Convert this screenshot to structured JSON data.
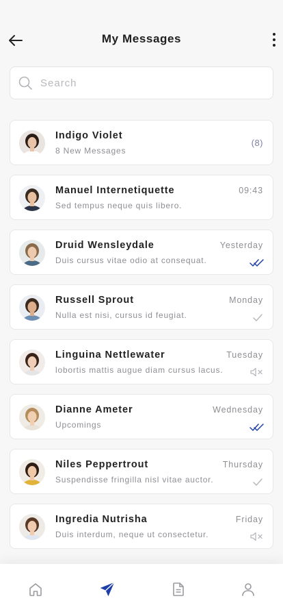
{
  "header": {
    "title": "My Messages"
  },
  "search": {
    "placeholder": "Search"
  },
  "colors": {
    "accent": "#1e3fa8",
    "muted": "#8e8e93",
    "count": "#7c80a6"
  },
  "conversations": [
    {
      "name": "Indigo Violet",
      "preview": "8 New Messages",
      "time": "",
      "count": "(8)",
      "status": "none",
      "avatar": "woman-dark-hair"
    },
    {
      "name": "Manuel Internetiquette",
      "preview": "Sed tempus neque quis libero.",
      "time": "09:43",
      "count": "",
      "status": "none",
      "avatar": "man-suit"
    },
    {
      "name": "Druid Wensleydale",
      "preview": "Duis cursus vitae odio at consequat.",
      "time": "Yesterday",
      "count": "",
      "status": "double-check-read",
      "avatar": "man-light-hair"
    },
    {
      "name": "Russell Sprout",
      "preview": "Nulla est nisi, cursus id feugiat.",
      "time": "Monday",
      "count": "",
      "status": "single-check",
      "avatar": "man-beard"
    },
    {
      "name": "Linguina Nettlewater",
      "preview": "lobortis mattis augue diam cursus lacus.",
      "time": "Tuesday",
      "count": "",
      "status": "muted",
      "avatar": "woman-dark-hair-2"
    },
    {
      "name": "Dianne Ameter",
      "preview": "Upcomings",
      "time": "Wednesday",
      "count": "",
      "status": "double-check-read",
      "avatar": "woman-blonde"
    },
    {
      "name": "Niles Peppertrout",
      "preview": "Suspendisse fringilla nisl vitae auctor.",
      "time": "Thursday",
      "count": "",
      "status": "single-check",
      "avatar": "woman-smiling"
    },
    {
      "name": "Ingredia Nutrisha",
      "preview": "Duis interdum, neque ut consectetur.",
      "time": "Friday",
      "count": "",
      "status": "muted",
      "avatar": "woman-brown-hair"
    }
  ],
  "tabs": [
    {
      "name": "home",
      "icon": "home-icon",
      "active": false
    },
    {
      "name": "messages",
      "icon": "send-icon",
      "active": true
    },
    {
      "name": "documents",
      "icon": "document-icon",
      "active": false
    },
    {
      "name": "profile",
      "icon": "user-icon",
      "active": false
    }
  ]
}
